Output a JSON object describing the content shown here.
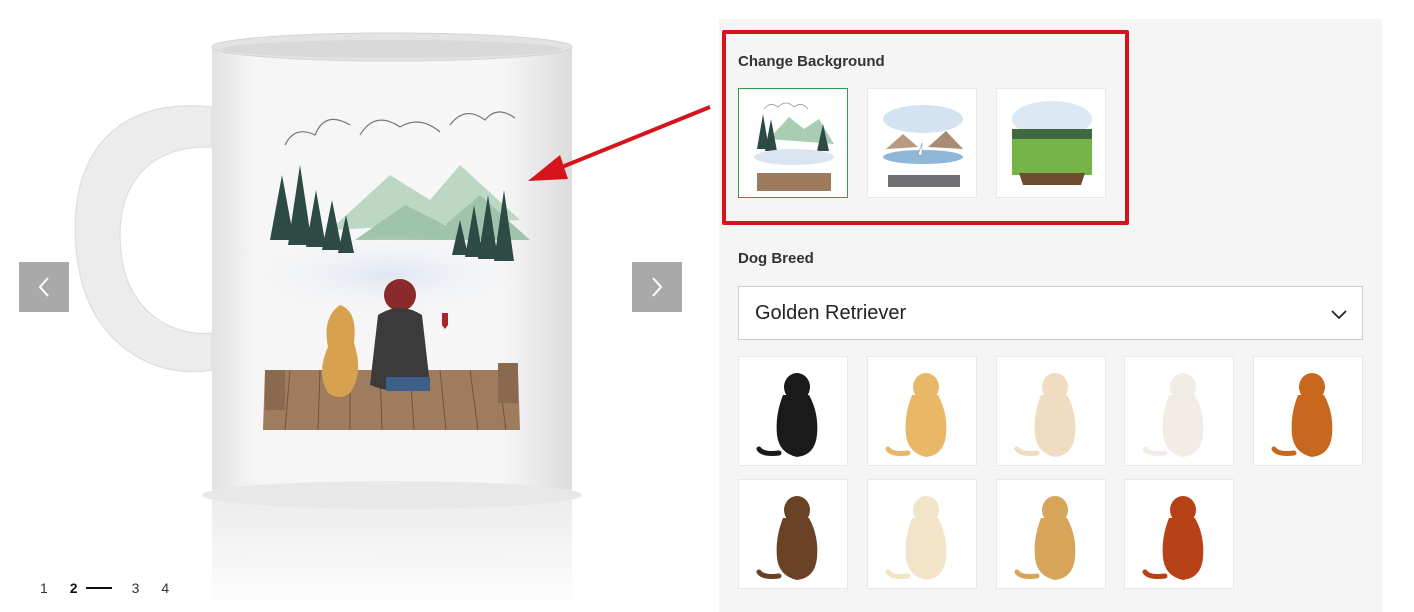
{
  "gallery": {
    "prev_label": "previous image",
    "next_label": "next image",
    "pages": [
      "1",
      "2",
      "3",
      "4"
    ],
    "active_page": 2
  },
  "personalize": {
    "background": {
      "label": "Change Background",
      "options": [
        {
          "name": "mountain-lake",
          "selected": true
        },
        {
          "name": "sailboat-lake",
          "selected": false
        },
        {
          "name": "green-meadow",
          "selected": false
        }
      ]
    },
    "breed": {
      "label": "Dog Breed",
      "selected": "Golden Retriever",
      "dog_colors": [
        "#1a1a1a",
        "#e9b867",
        "#f0dcc0",
        "#f1ede6",
        "#c8681e",
        "#6a4326",
        "#f2e4c8",
        "#d6a55a",
        "#b64216"
      ]
    }
  },
  "colors": {
    "accent_highlight": "#d6141c",
    "selected_border": "#2fa04a",
    "panel_bg": "#f5f5f6",
    "nav_bg": "#a9a9a9"
  }
}
